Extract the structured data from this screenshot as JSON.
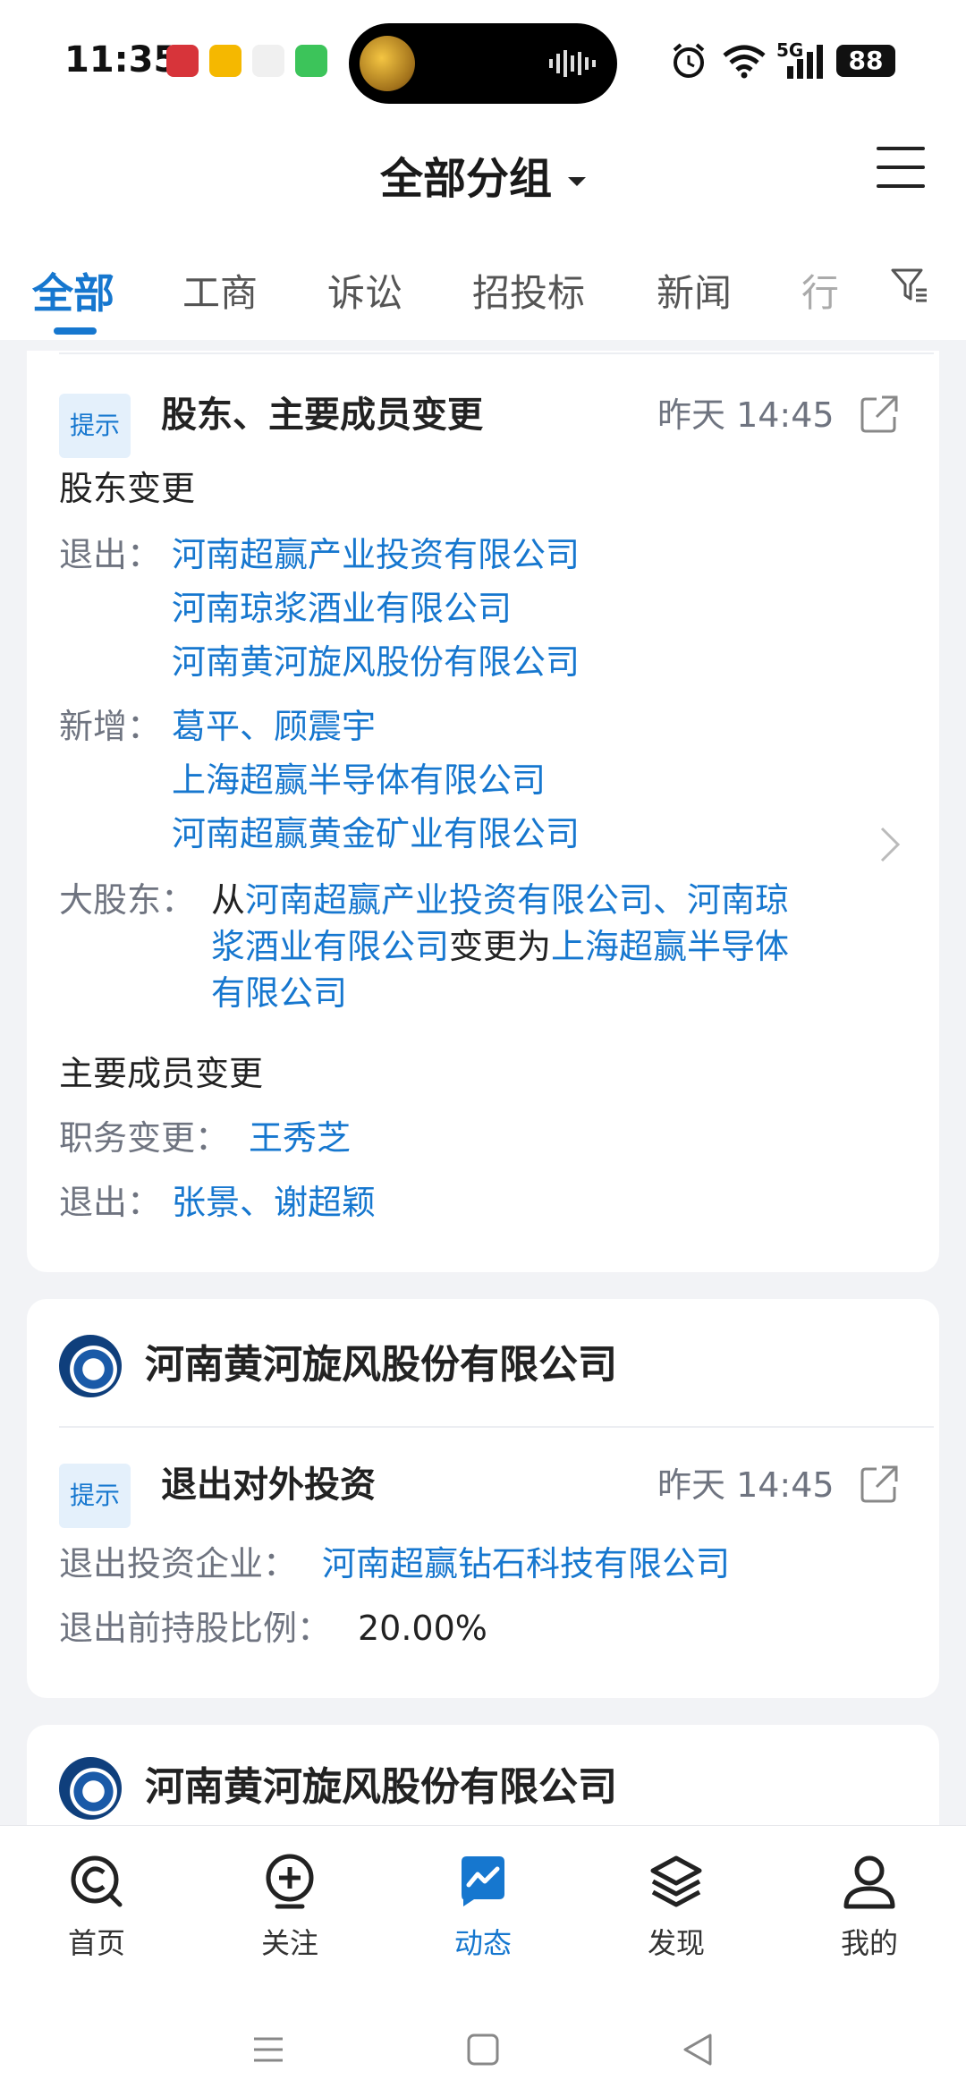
{
  "status": {
    "time": "11:35",
    "battery": "88",
    "network": "5G"
  },
  "header": {
    "title": "全部分组"
  },
  "tabs": [
    {
      "label": "全部",
      "active": true
    },
    {
      "label": "工商"
    },
    {
      "label": "诉讼"
    },
    {
      "label": "招投标"
    },
    {
      "label": "新闻"
    },
    {
      "label": "行"
    }
  ],
  "card1": {
    "tag": "提示",
    "title": "股东、主要成员变更",
    "time": "昨天 14:45",
    "section1": "股东变更",
    "exit_label": "退出：",
    "exit_items": [
      "河南超赢产业投资有限公司",
      "河南琼浆酒业有限公司",
      "河南黄河旋风股份有限公司"
    ],
    "add_label": "新增：",
    "add_people": "葛平、顾震宇",
    "add_items": [
      "上海超赢半导体有限公司",
      "河南超赢黄金矿业有限公司"
    ],
    "major_label": "大股东：",
    "major_from_prefix": "从",
    "major_line1_link": "河南超赢产业投资有限公司、河南琼",
    "major_line2_link": "浆酒业有限公司",
    "major_line2_text": "变更为",
    "major_line2_link2": "上海超赢半导体",
    "major_line3_link": "有限公司",
    "section2": "主要成员变更",
    "duty_label": "职务变更：",
    "duty_value": "王秀芝",
    "exit2_label": "退出：",
    "exit2_value": "张景、谢超颖"
  },
  "card2": {
    "company": "河南黄河旋风股份有限公司",
    "tag": "提示",
    "title": "退出对外投资",
    "time": "昨天 14:45",
    "invest_label": "退出投资企业：",
    "invest_value": "河南超赢钻石科技有限公司",
    "ratio_label": "退出前持股比例：",
    "ratio_value": "20.00%"
  },
  "card3": {
    "company": "河南黄河旋风股份有限公司"
  },
  "nav": [
    {
      "label": "首页",
      "icon": "home-search-icon"
    },
    {
      "label": "关注",
      "icon": "follow-plus-icon"
    },
    {
      "label": "动态",
      "icon": "trend-chart-icon",
      "active": true
    },
    {
      "label": "发现",
      "icon": "layers-icon"
    },
    {
      "label": "我的",
      "icon": "profile-icon"
    }
  ],
  "colors": {
    "accent": "#1677cf",
    "tag_bg": "#e4f0fb",
    "page_bg": "#f2f3f6"
  }
}
